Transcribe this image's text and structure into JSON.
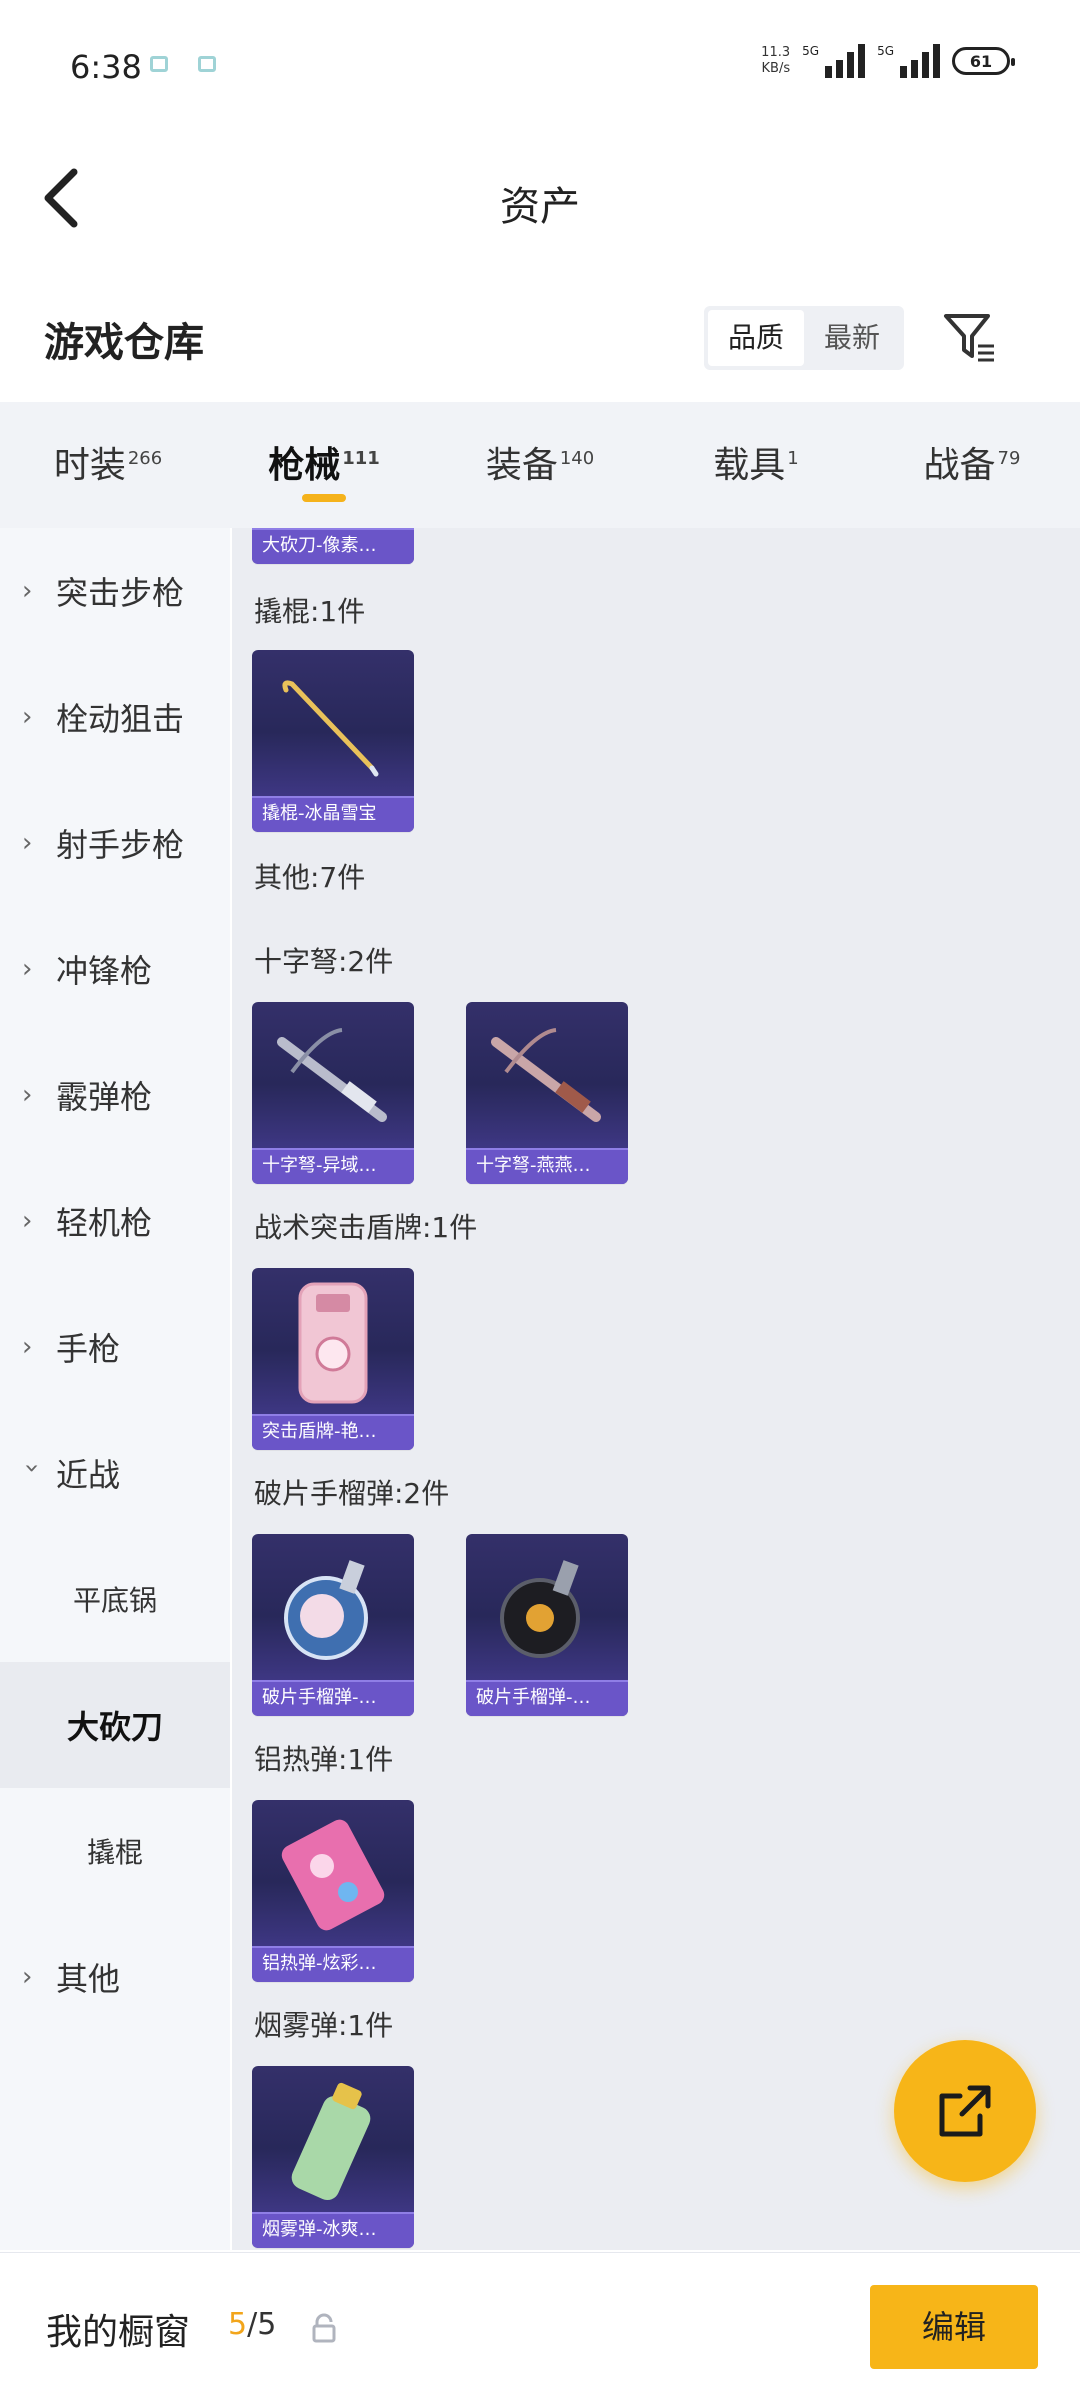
{
  "status_bar": {
    "time": "6:38",
    "net_speed_value": "11.3",
    "net_speed_unit": "KB/s",
    "sim1_type": "5G",
    "sim2_type": "5G",
    "battery": "61"
  },
  "header": {
    "title": "资产"
  },
  "warehouse": {
    "title": "游戏仓库",
    "sort_options": [
      "品质",
      "最新"
    ]
  },
  "tabs": [
    {
      "label": "时装",
      "count": "266"
    },
    {
      "label": "枪械",
      "count": "111"
    },
    {
      "label": "装备",
      "count": "140"
    },
    {
      "label": "载具",
      "count": "1"
    },
    {
      "label": "战备",
      "count": "79"
    }
  ],
  "sidebar": [
    {
      "label": "突击步枪"
    },
    {
      "label": "栓动狙击"
    },
    {
      "label": "射手步枪"
    },
    {
      "label": "冲锋枪"
    },
    {
      "label": "霰弹枪"
    },
    {
      "label": "轻机枪"
    },
    {
      "label": "手枪"
    },
    {
      "label": "近战"
    },
    {
      "label": "平底锅"
    },
    {
      "label": "大砍刀"
    },
    {
      "label": "撬棍"
    },
    {
      "label": "其他"
    }
  ],
  "content": {
    "top_partial_card": "大砍刀-像素…",
    "groups": [
      {
        "title": "撬棍:1件",
        "items": [
          "撬棍-冰晶雪宝"
        ]
      },
      {
        "title": "其他:7件",
        "items": []
      },
      {
        "title": "十字弩:2件",
        "items": [
          "十字弩-异域…",
          "十字弩-燕燕…"
        ]
      },
      {
        "title": "战术突击盾牌:1件",
        "items": [
          "突击盾牌-艳…"
        ]
      },
      {
        "title": "破片手榴弹:2件",
        "items": [
          "破片手榴弹-…",
          "破片手榴弹-…"
        ]
      },
      {
        "title": "铝热弹:1件",
        "items": [
          "铝热弹-炫彩…"
        ]
      },
      {
        "title": "烟雾弹:1件",
        "items": [
          "烟雾弹-冰爽…"
        ]
      }
    ]
  },
  "bottom_bar": {
    "label": "我的橱窗",
    "count_current": "5",
    "count_total": "/5",
    "edit_label": "编辑"
  },
  "colors": {
    "accent": "#f7b518",
    "card_bg": "#2c2a63",
    "card_caption": "#6a55c8"
  }
}
